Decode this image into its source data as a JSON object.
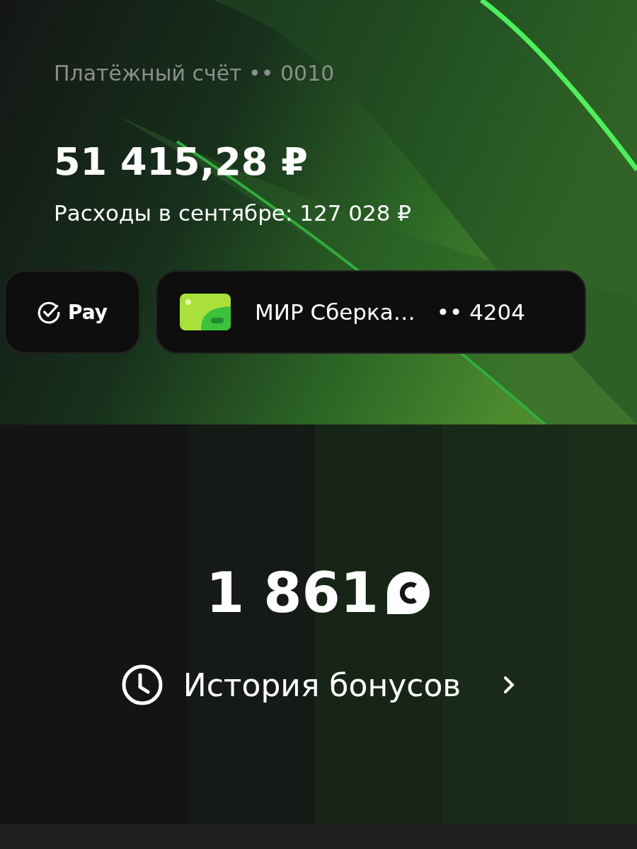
{
  "account": {
    "title": "Платёжный счёт •• 0010",
    "balance": "51 415,28 ₽",
    "expenses": "Расходы в сентябре: 127 028 ₽"
  },
  "payment_chips": [
    {
      "kind": "pay",
      "label": "Pay"
    },
    {
      "kind": "card",
      "label": "МИР Сберка…",
      "number": "•• 4204"
    }
  ],
  "bonuses": {
    "amount": "1 861",
    "history_link": "История бонусов"
  }
}
